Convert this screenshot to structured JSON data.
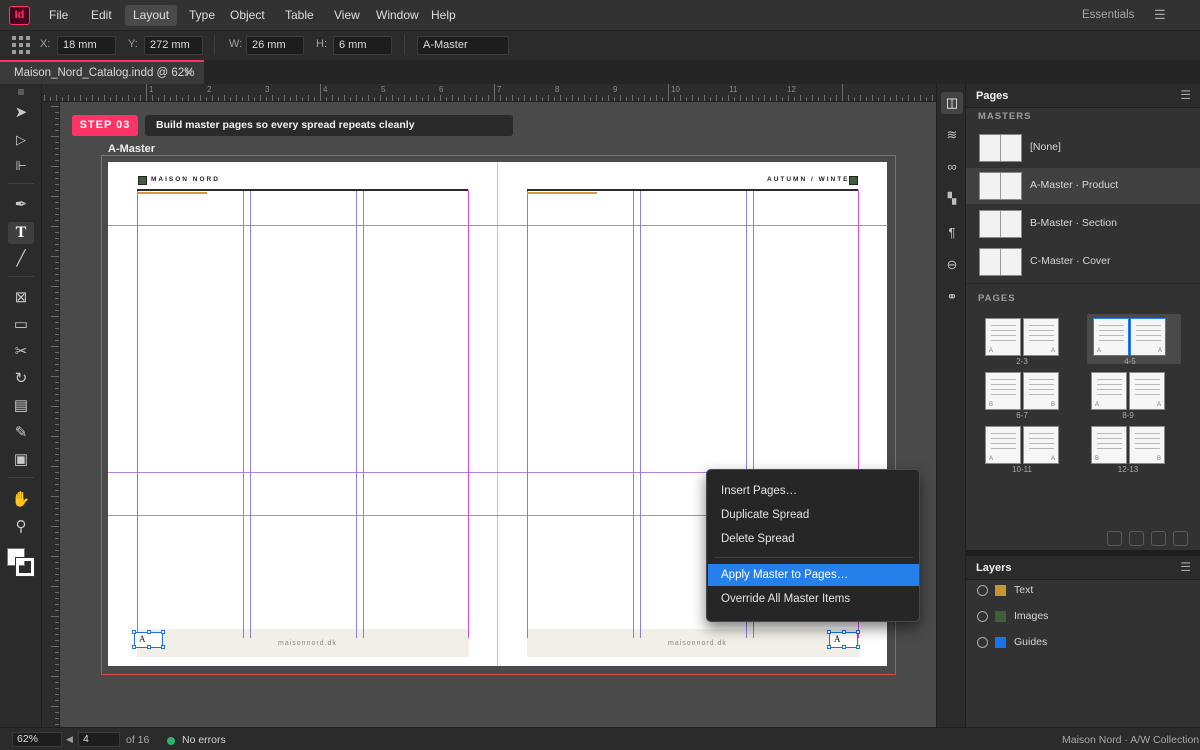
{
  "app": {
    "logo": "Id",
    "menu": [
      "File",
      "Edit",
      "Layout",
      "Type",
      "Object",
      "Table",
      "View",
      "Window",
      "Help"
    ],
    "active_menu": "Layout",
    "workspace": "Essentials",
    "workspace_menu_icon": "hamburger-icon"
  },
  "control_bar": {
    "x_label": "X:",
    "x_value": "18 mm",
    "y_label": "Y:",
    "y_value": "272 mm",
    "w_label": "W:",
    "w_value": "26 mm",
    "h_label": "H:",
    "h_value": "6 mm",
    "master_value": "A-Master"
  },
  "document_tab": {
    "label": "Maison_Nord_Catalog.indd @ 62%",
    "close": "✕"
  },
  "ruler": {
    "numbers": [
      "1",
      "2",
      "3",
      "4",
      "5",
      "6",
      "7",
      "8",
      "9",
      "10",
      "11",
      "12"
    ]
  },
  "canvas": {
    "step_badge": "STEP 03",
    "step_description": "Build master pages so every spread repeats cleanly",
    "spread_label": "A-Master",
    "left_page": {
      "header": "MAISON NORD",
      "footer_url": "maisonnord.dk",
      "folio": "A"
    },
    "right_page": {
      "header": "AUTUMN / WINTER",
      "footer_url": "maisonnord.dk",
      "folio": "A"
    }
  },
  "context_menu": {
    "items": [
      "Insert Pages…",
      "Duplicate Spread",
      "Delete Spread"
    ],
    "items2": [
      "Apply Master to Pages…",
      "Override All Master Items"
    ],
    "highlighted": "Apply Master to Pages…"
  },
  "pages_panel": {
    "title": "Pages",
    "masters_label": "MASTERS",
    "masters": [
      "[None]",
      "A-Master · Product",
      "B-Master · Section",
      "C-Master · Cover"
    ],
    "selected_master": "A-Master · Product",
    "pages_label": "PAGES",
    "spreads": [
      {
        "label": "2-3",
        "left": "A",
        "right": "A"
      },
      {
        "label": "4-5",
        "left": "A",
        "right": "A"
      },
      {
        "label": "6-7",
        "left": "B",
        "right": "B"
      },
      {
        "label": "8-9",
        "left": "A",
        "right": "A"
      },
      {
        "label": "10-11",
        "left": "A",
        "right": "A"
      },
      {
        "label": "12-13",
        "left": "B",
        "right": "B"
      }
    ],
    "selected_spread": "4-5"
  },
  "layers_panel": {
    "title": "Layers",
    "layers": [
      {
        "name": "Text",
        "color": "#c8962e"
      },
      {
        "name": "Images",
        "color": "#3f5e3a"
      },
      {
        "name": "Guides",
        "color": "#1a73e8"
      }
    ]
  },
  "status_bar": {
    "zoom": "62%",
    "page": "4",
    "page_total": "of 16",
    "preflight": "No errors",
    "document_info": "Maison Nord · A/W Collection"
  },
  "colors": {
    "accent": "#ff3366",
    "highlight": "#2680eb",
    "status_ok": "#2fb46b"
  }
}
